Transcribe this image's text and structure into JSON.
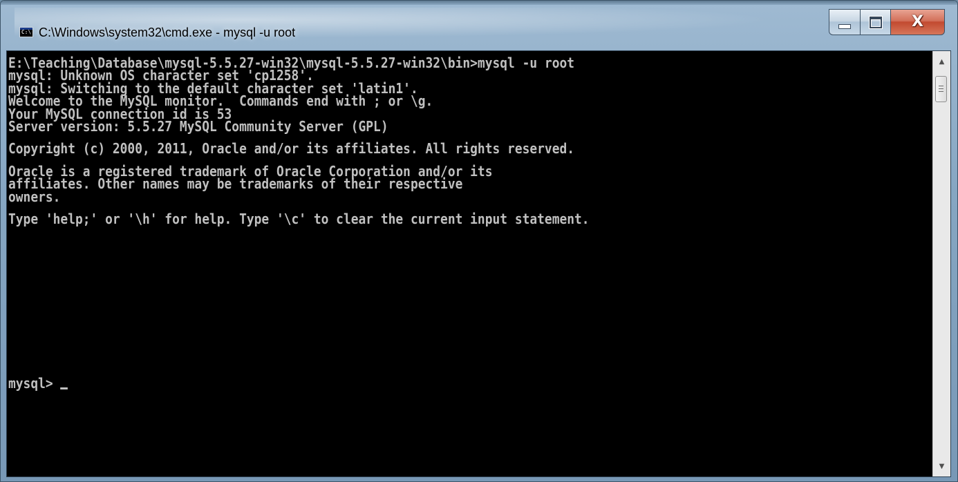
{
  "window": {
    "title": "C:\\Windows\\system32\\cmd.exe - mysql  -u root",
    "icon": "cmd-icon",
    "icon_text": "C:\\",
    "buttons": {
      "minimize": "minimize-icon",
      "maximize": "maximize-icon",
      "close": "close-icon",
      "close_glyph": "X"
    }
  },
  "console": {
    "lines": [
      "E:\\Teaching\\Database\\mysql-5.5.27-win32\\mysql-5.5.27-win32\\bin>mysql -u root",
      "mysql: Unknown OS character set 'cp1258'.",
      "mysql: Switching to the default character set 'latin1'.",
      "Welcome to the MySQL monitor.  Commands end with ; or \\g.",
      "Your MySQL connection id is 53",
      "Server version: 5.5.27 MySQL Community Server (GPL)",
      "",
      "Copyright (c) 2000, 2011, Oracle and/or its affiliates. All rights reserved.",
      "",
      "Oracle is a registered trademark of Oracle Corporation and/or its",
      "affiliates. Other names may be trademarks of their respective",
      "owners.",
      "",
      "Type 'help;' or '\\h' for help. Type '\\c' to clear the current input statement.",
      ""
    ],
    "prompt": "mysql> ",
    "text_color": "#c0c0c0",
    "background_color": "#000000"
  },
  "scrollbar": {
    "up_arrow": "scroll-up-arrow-icon",
    "down_arrow": "scroll-down-arrow-icon"
  }
}
